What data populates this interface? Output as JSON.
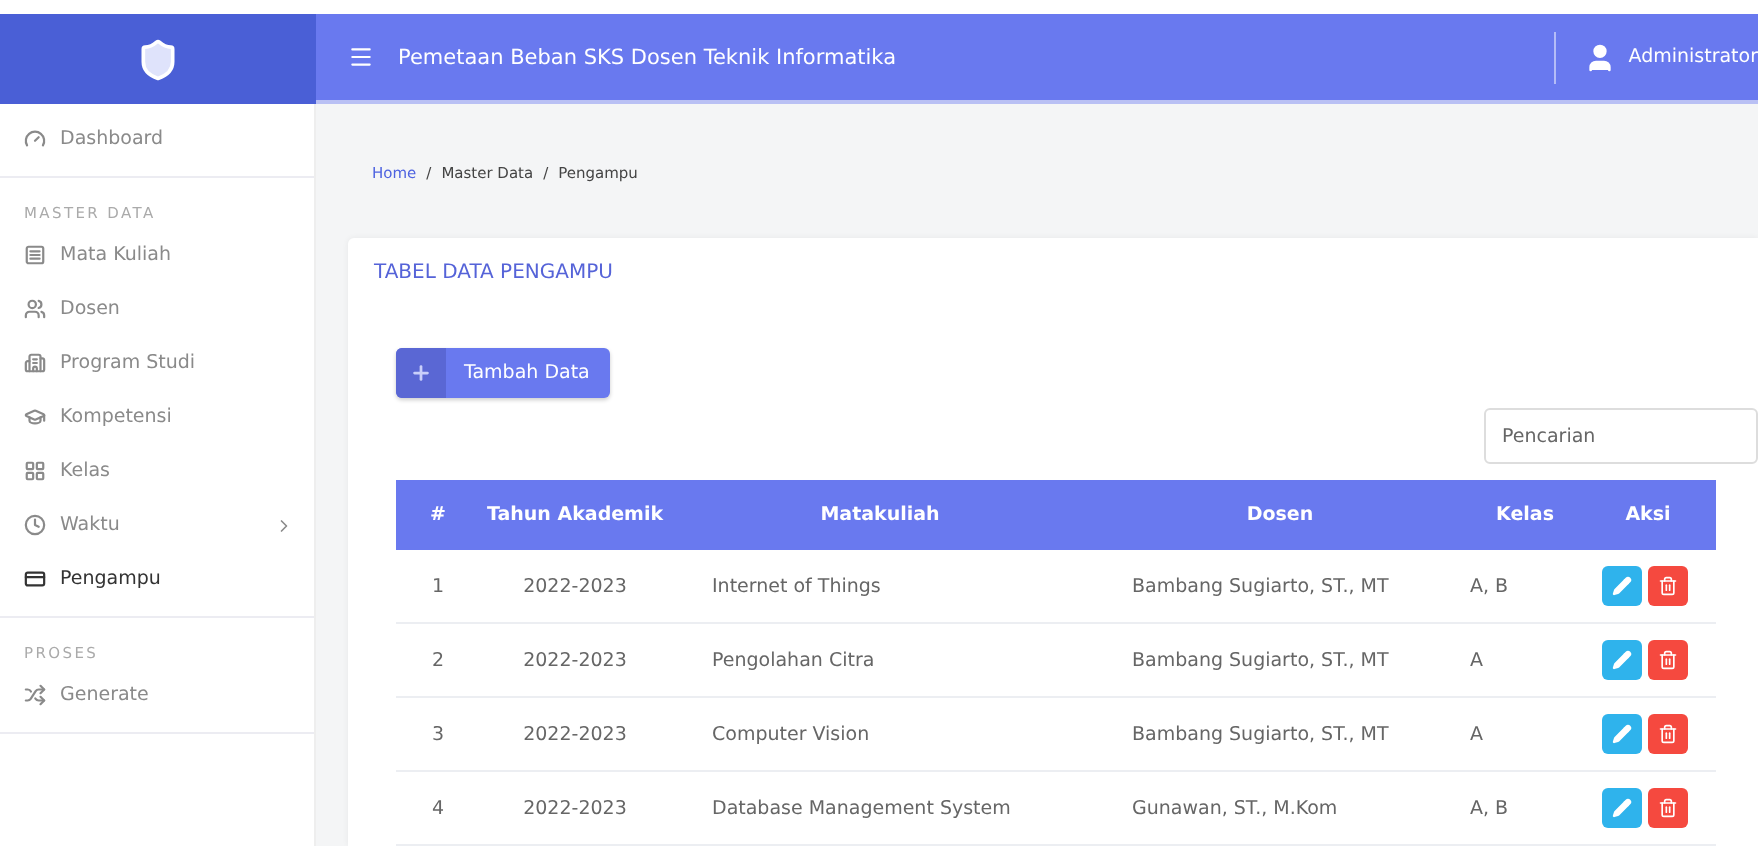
{
  "header": {
    "title": "Pemetaan Beban SKS Dosen Teknik Informatika",
    "user": "Administrator"
  },
  "sidebar": {
    "top": [
      {
        "label": "Dashboard",
        "selected": false
      }
    ],
    "sections": [
      {
        "heading": "MASTER DATA",
        "items": [
          {
            "label": "Mata Kuliah",
            "selected": false,
            "has_submenu": false
          },
          {
            "label": "Dosen",
            "selected": false,
            "has_submenu": false
          },
          {
            "label": "Program Studi",
            "selected": false,
            "has_submenu": false
          },
          {
            "label": "Kompetensi",
            "selected": false,
            "has_submenu": false
          },
          {
            "label": "Kelas",
            "selected": false,
            "has_submenu": false
          },
          {
            "label": "Waktu",
            "selected": false,
            "has_submenu": true
          },
          {
            "label": "Pengampu",
            "selected": true,
            "has_submenu": false
          }
        ]
      },
      {
        "heading": "PROSES",
        "items": [
          {
            "label": "Generate",
            "selected": false,
            "has_submenu": false
          }
        ]
      }
    ]
  },
  "breadcrumb": [
    {
      "kind": "link",
      "text": "Home"
    },
    {
      "kind": "separator",
      "text": "/"
    },
    {
      "kind": "item",
      "text": "Master Data"
    },
    {
      "kind": "separator",
      "text": "/"
    },
    {
      "kind": "item",
      "text": "Pengampu"
    }
  ],
  "card": {
    "title": "TABEL DATA PENGAMPU",
    "add_button": "Tambah Data",
    "search": {
      "placeholder": "Pencarian"
    },
    "table": {
      "columns": [
        "#",
        "Tahun Akademik",
        "Matakuliah",
        "Dosen",
        "Kelas",
        "Aksi"
      ],
      "rows": [
        [
          "1",
          "2022-2023",
          "Internet of Things",
          "Bambang Sugiarto, ST., MT",
          "A, B"
        ],
        [
          "2",
          "2022-2023",
          "Pengolahan Citra",
          "Bambang Sugiarto, ST., MT",
          "A"
        ],
        [
          "3",
          "2022-2023",
          "Computer Vision",
          "Bambang Sugiarto, ST., MT",
          "A"
        ],
        [
          "4",
          "2022-2023",
          "Database Management System",
          "Gunawan, ST., M.Kom",
          "A, B"
        ]
      ]
    }
  }
}
